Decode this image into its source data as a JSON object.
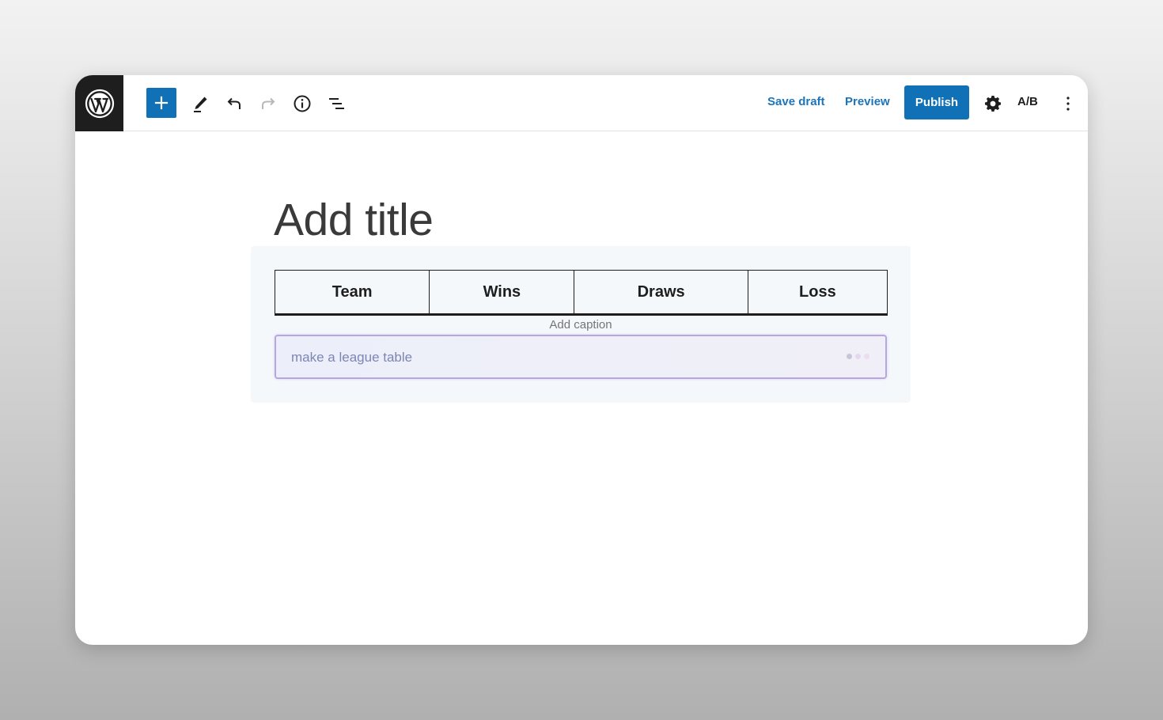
{
  "toolbar": {
    "save_draft_label": "Save draft",
    "preview_label": "Preview",
    "publish_label": "Publish",
    "ab_label": "A/B",
    "icons": [
      "wordpress-logo-icon",
      "plus-icon",
      "pencil-icon",
      "undo-icon",
      "redo-icon",
      "info-icon",
      "list-view-icon",
      "gear-icon",
      "more-vertical-icon"
    ]
  },
  "editor": {
    "title_placeholder": "Add title",
    "table": {
      "headers": [
        "Team",
        "Wins",
        "Draws",
        "Loss"
      ]
    },
    "caption_placeholder": "Add caption",
    "prompt_value": "make a league table"
  },
  "colors": {
    "accent": "#1071b6",
    "link": "#1b75bc",
    "topbar_logo_bg": "#1e1e1e"
  }
}
